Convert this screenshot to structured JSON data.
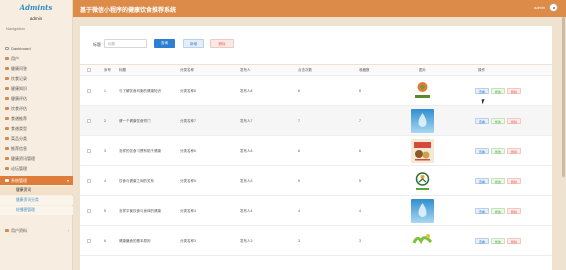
{
  "app": {
    "logo_text": "Admints",
    "user_label": "admin",
    "system_title": "基于微信小程序的健康饮食推荐系统",
    "header_username": "admin"
  },
  "sidebar": {
    "heading": "Navigation",
    "items": [
      {
        "label": "Dashboard"
      },
      {
        "label": "用户"
      },
      {
        "label": "健康问答"
      },
      {
        "label": "饮食记录"
      },
      {
        "label": "健康知识"
      },
      {
        "label": "健康评估"
      },
      {
        "label": "饮食评估"
      },
      {
        "label": "食谱推荐"
      },
      {
        "label": "食谱类型"
      },
      {
        "label": "菜品分类"
      },
      {
        "label": "推荐信息"
      },
      {
        "label": "健康资讯管理"
      },
      {
        "label": "论坛管理"
      },
      {
        "label": "系统管理"
      },
      {
        "label": "用户资料"
      }
    ],
    "subitems": [
      {
        "label": "健康资讯"
      },
      {
        "label": "健康资讯分类"
      },
      {
        "label": "轮播图管理"
      }
    ]
  },
  "search": {
    "label": "标题",
    "placeholder": "标题",
    "search_button": "查询",
    "add_button": "新增",
    "delete_button": "删除"
  },
  "table": {
    "headers": [
      "",
      "序号",
      "标题",
      "分类名称",
      "发布人",
      "点击次数",
      "收藏数",
      "图片",
      "操作"
    ],
    "actions": {
      "view": "查看",
      "edit": "修改",
      "delete": "删除"
    },
    "rows": [
      {
        "index": "1",
        "title": "与了解饮食均衡的健康知识",
        "category": "分类名称8",
        "author": "发布人8",
        "clicks": "8",
        "favorites": "8",
        "image_icon": "health-logo-icon"
      },
      {
        "index": "2",
        "title": "健一个健康饮食窍门",
        "category": "分类名称7",
        "author": "发布人7",
        "clicks": "7",
        "favorites": "7",
        "image_icon": "water-drop-icon"
      },
      {
        "index": "3",
        "title": "怎样的饮食习惯有助于健康",
        "category": "分类名称6",
        "author": "发布人6",
        "clicks": "6",
        "favorites": "6",
        "image_icon": "food-poster-icon"
      },
      {
        "index": "4",
        "title": "饮食与健康之间的关系",
        "category": "分类名称5",
        "author": "发布人5",
        "clicks": "5",
        "favorites": "5",
        "image_icon": "health-badge-icon"
      },
      {
        "index": "5",
        "title": "怎样平衡饮食与身体的健康",
        "category": "分类名称4",
        "author": "发布人4",
        "clicks": "4",
        "favorites": "4",
        "image_icon": "water-drop-icon"
      },
      {
        "index": "6",
        "title": "健康膳食的基本原则",
        "category": "分类名称3",
        "author": "发布人3",
        "clicks": "3",
        "favorites": "3",
        "image_icon": "green-text-icon"
      }
    ]
  },
  "colors": {
    "header": "#dc8b49",
    "sidebar_active": "#e07c3a",
    "primary": "#2d7fd3",
    "danger": "#e06b5a",
    "success": "#4da33c"
  }
}
